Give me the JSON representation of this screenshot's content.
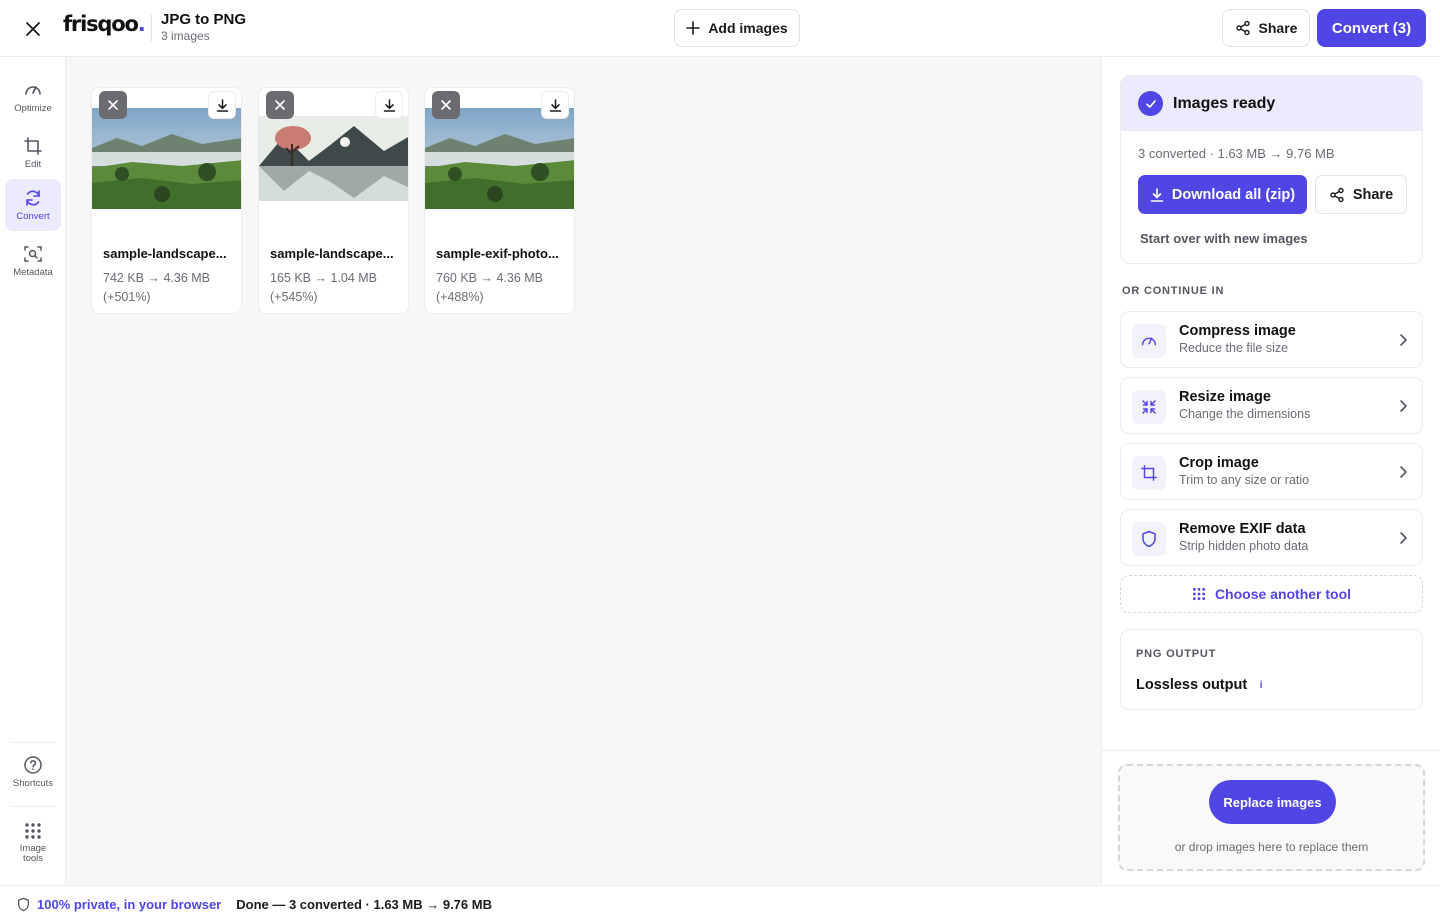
{
  "header": {
    "logo": "frisqoo",
    "logo_dot": ".",
    "title": "JPG to PNG",
    "subtitle": "3 images",
    "add_images_label": "Add images",
    "share_label": "Share",
    "convert_label": "Convert (3)"
  },
  "nav": {
    "items": [
      {
        "label": "Optimize",
        "icon": "gauge-icon"
      },
      {
        "label": "Edit",
        "icon": "crop-icon"
      },
      {
        "label": "Convert",
        "icon": "refresh-icon",
        "active": true
      },
      {
        "label": "Metadata",
        "icon": "scan-icon"
      }
    ],
    "bottom": [
      {
        "label": "Shortcuts",
        "icon": "help-icon"
      },
      {
        "label": "Image tools",
        "icon": "grid-icon"
      }
    ]
  },
  "images": [
    {
      "name": "sample-landscape...",
      "size": "742 KB → 4.36 MB",
      "change": "(+501%)"
    },
    {
      "name": "sample-landscape...",
      "size": "165 KB → 1.04 MB",
      "change": "(+545%)"
    },
    {
      "name": "sample-exif-photo...",
      "size": "760 KB → 4.36 MB",
      "change": "(+488%)"
    }
  ],
  "ready": {
    "title": "Images ready",
    "stats": "3 converted · 1.63 MB → 9.76 MB",
    "download_label": "Download all (zip)",
    "share_label": "Share",
    "start_over": "Start over with new images"
  },
  "continue": {
    "heading": "OR CONTINUE IN",
    "tools": [
      {
        "name": "Compress image",
        "desc": "Reduce the file size",
        "icon": "gauge-icon"
      },
      {
        "name": "Resize image",
        "desc": "Change the dimensions",
        "icon": "shrink-icon"
      },
      {
        "name": "Crop image",
        "desc": "Trim to any size or ratio",
        "icon": "crop-icon"
      },
      {
        "name": "Remove EXIF data",
        "desc": "Strip hidden photo data",
        "icon": "shield-icon"
      }
    ],
    "choose_label": "Choose another tool"
  },
  "output": {
    "label": "PNG OUTPUT",
    "value": "Lossless output",
    "info": "i"
  },
  "drop": {
    "button_label": "Replace images",
    "hint": "or drop images here to replace them"
  },
  "status": {
    "private": "100% private, in your browser",
    "text": "Done — 3 converted · 1.63 MB → 9.76 MB"
  },
  "colors": {
    "accent": "#5046e5",
    "accent_soft": "#eceafd"
  }
}
